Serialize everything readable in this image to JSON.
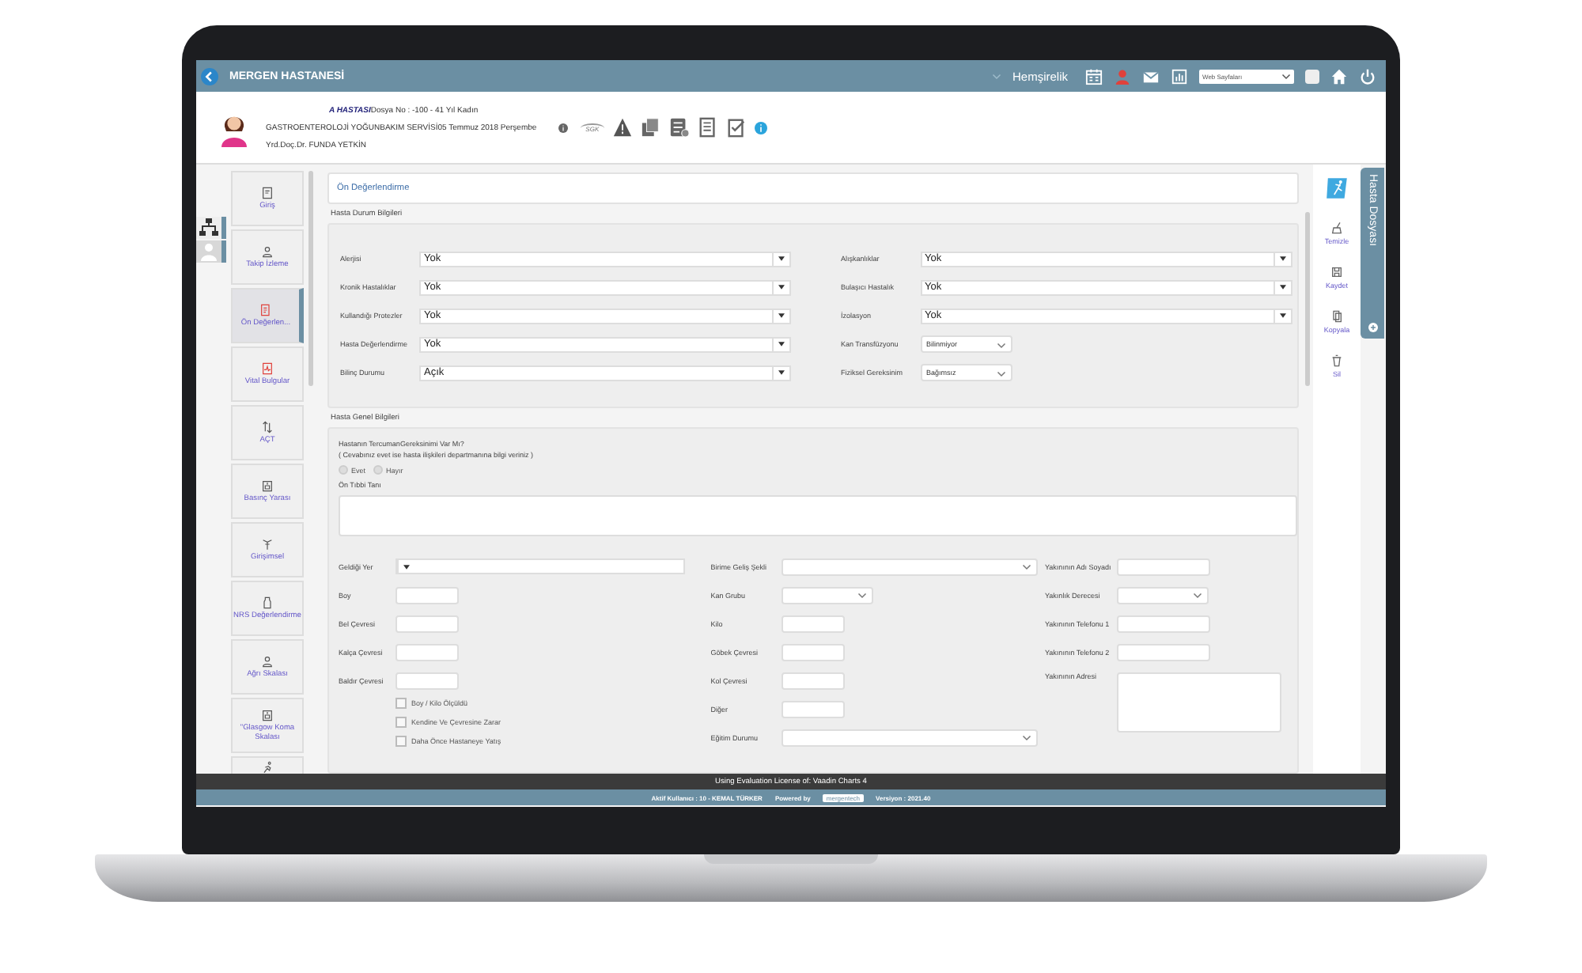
{
  "app_bar": {
    "title": "MERGEN HASTANESİ",
    "module": "Hemşirelik",
    "web_select": {
      "value": "Web Sayfaları"
    }
  },
  "patient": {
    "name": "A HASTASI",
    "file_info": "Dosya No : -100 - 41 Yıl Kadın",
    "ward_date": "GASTROENTEROLOJİ YOĞUNBAKIM SERVİSİ05 Temmuz 2018 Perşembe",
    "doctor": "Yrd.Doç.Dr. FUNDA YETKİN",
    "insurance_label": "SGK"
  },
  "nav": [
    {
      "label": "Giriş",
      "kind": "login",
      "selected": false
    },
    {
      "label": "Takip İzleme",
      "kind": "person",
      "selected": false
    },
    {
      "label": "Ön Değerlen...",
      "kind": "form",
      "selected": true
    },
    {
      "label": "Vital Bulgular",
      "kind": "vital",
      "selected": false
    },
    {
      "label": "AÇT",
      "kind": "arrows",
      "selected": false
    },
    {
      "label": "Basınç Yarası",
      "kind": "frame",
      "selected": false
    },
    {
      "label": "Girişimsel",
      "kind": "antenna",
      "selected": false
    },
    {
      "label": "NRS Değerlendirme",
      "kind": "bottle",
      "selected": false
    },
    {
      "label": "Ağrı Skalası",
      "kind": "person",
      "selected": false
    },
    {
      "label": "\"Glasgow Koma Skalası",
      "kind": "frame",
      "selected": false
    },
    {
      "kind": "run",
      "selected": false
    }
  ],
  "page_title": "Ön Değerlendirme",
  "status_section": {
    "title": "Hasta Durum Bilgileri",
    "left": [
      {
        "label": "Alerjisi",
        "value": "Yok",
        "kind": "combo"
      },
      {
        "label": "Kronik Hastalıklar",
        "value": "Yok",
        "kind": "combo"
      },
      {
        "label": "Kullandığı Protezler",
        "value": "Yok",
        "kind": "combo"
      },
      {
        "label": "Hasta Değerlendirme",
        "value": "Yok",
        "kind": "combo"
      },
      {
        "label": "Bilinç Durumu",
        "value": "Açık",
        "kind": "combo"
      }
    ],
    "right": [
      {
        "label": "Alışkanlıklar",
        "value": "Yok",
        "kind": "combo"
      },
      {
        "label": "Bulaşıcı Hastalık",
        "value": "Yok",
        "kind": "combo"
      },
      {
        "label": "İzolasyon",
        "value": "Yok",
        "kind": "combo"
      },
      {
        "label": "Kan Transfüzyonu",
        "value": "Bilinmiyor",
        "kind": "picker"
      },
      {
        "label": "Fiziksel Gereksinim",
        "value": "Bağımsız",
        "kind": "picker"
      }
    ]
  },
  "general_section": {
    "title": "Hasta Genel Bilgileri",
    "question": "Hastanın TercumanGereksinimi Var Mı?",
    "note": "( Cevabınız evet ise hasta ilişkileri departmanına bilgi veriniz )",
    "options": [
      {
        "label": "Evet",
        "selected": false
      },
      {
        "label": "Hayır",
        "selected": false
      }
    ],
    "diagnosis_label": "Ön Tıbbi Tanı",
    "col1": [
      {
        "label": "Geldiği Yer",
        "kind": "combo"
      },
      {
        "label": "Boy",
        "kind": "input"
      },
      {
        "label": "Bel Çevresi",
        "kind": "input"
      },
      {
        "label": "Kalça Çevresi",
        "kind": "input"
      },
      {
        "label": "Baldır Çevresi",
        "kind": "input"
      }
    ],
    "checks": [
      {
        "label": "Boy / Kilo Ölçüldü",
        "checked": false
      },
      {
        "label": "Kendine Ve Çevresine Zarar",
        "checked": false
      },
      {
        "label": "Daha Önce Hastaneye Yatış",
        "checked": false
      }
    ],
    "col2": [
      {
        "label": "Birime Geliş Şekli",
        "kind": "dropdown"
      },
      {
        "label": "Kan Grubu",
        "kind": "picker"
      },
      {
        "label": "Kilo",
        "kind": "input"
      },
      {
        "label": "Göbek Çevresi",
        "kind": "input"
      },
      {
        "label": "Kol Çevresi",
        "kind": "input"
      },
      {
        "label": "Diğer",
        "kind": "input"
      },
      {
        "label": "Eğitim Durumu",
        "kind": "dropdown"
      }
    ],
    "col3": [
      {
        "label": "Yakınının Adı Soyadı",
        "kind": "input"
      },
      {
        "label": "Yakınlık Derecesi",
        "kind": "picker"
      },
      {
        "label": "Yakınının Telefonu 1",
        "kind": "input"
      },
      {
        "label": "Yakınının Telefonu 2",
        "kind": "input"
      },
      {
        "label": "Yakınının Adresi",
        "kind": "textarea"
      }
    ]
  },
  "tools": [
    {
      "label": "Temizle",
      "kind": "broom"
    },
    {
      "label": "Kaydet",
      "kind": "save"
    },
    {
      "label": "Kopyala",
      "kind": "copy"
    },
    {
      "label": "Sil",
      "kind": "trash"
    }
  ],
  "side_tab": "Hasta Dosyası",
  "license": "Using Evaluation License of: Vaadin Charts 4",
  "footer": {
    "user": "Aktif Kullanıcı : 10 - KEMAL TÜRKER",
    "powered": "Powered by",
    "brand": "mergentech",
    "version": "Versiyon : 2021.40"
  }
}
